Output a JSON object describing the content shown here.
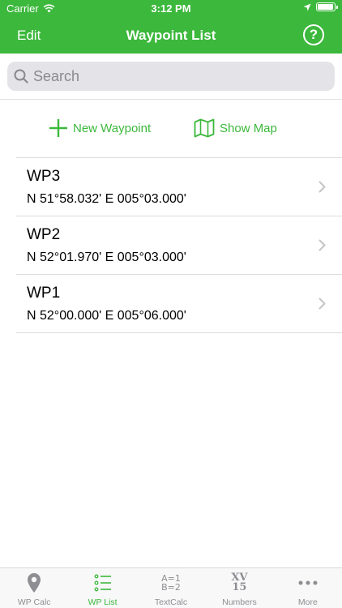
{
  "colors": {
    "accent": "#3cb83c"
  },
  "status_bar": {
    "carrier": "Carrier",
    "time": "3:12 PM",
    "battery_level": 0.95
  },
  "nav": {
    "edit_label": "Edit",
    "title": "Waypoint List",
    "help_label": "?"
  },
  "search": {
    "placeholder": "Search",
    "value": ""
  },
  "actions": {
    "new_waypoint": "New Waypoint",
    "show_map": "Show Map"
  },
  "waypoints": [
    {
      "name": "WP3",
      "coords": "N 51°58.032' E 005°03.000'"
    },
    {
      "name": "WP2",
      "coords": "N 52°01.970' E 005°03.000'"
    },
    {
      "name": "WP1",
      "coords": "N 52°00.000' E 005°06.000'"
    }
  ],
  "tabs": [
    {
      "label": "WP Calc",
      "icon": "location-pin-icon",
      "active": false
    },
    {
      "label": "WP List",
      "icon": "list-icon",
      "active": true
    },
    {
      "label": "TextCalc",
      "icon": "text-calc-icon",
      "glyph_lines": [
        "A=1",
        "B=2"
      ],
      "active": false
    },
    {
      "label": "Numbers",
      "icon": "roman-numerals-icon",
      "glyph_lines": [
        "XV",
        "15"
      ],
      "active": false
    },
    {
      "label": "More",
      "icon": "more-icon",
      "active": false
    }
  ]
}
